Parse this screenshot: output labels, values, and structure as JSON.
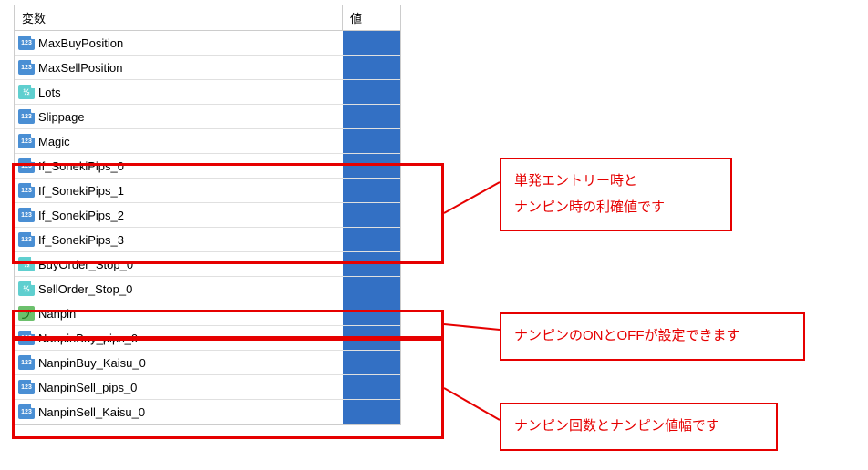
{
  "header": {
    "var_label": "変数",
    "val_label": "値"
  },
  "rows": [
    {
      "icon": "123",
      "name": "MaxBuyPosition"
    },
    {
      "icon": "123",
      "name": "MaxSellPosition"
    },
    {
      "icon": "v2",
      "name": "Lots"
    },
    {
      "icon": "123",
      "name": "Slippage"
    },
    {
      "icon": "123",
      "name": "Magic"
    },
    {
      "icon": "123",
      "name": "If_SonekiPips_0"
    },
    {
      "icon": "123",
      "name": "If_SonekiPips_1"
    },
    {
      "icon": "123",
      "name": "If_SonekiPips_2"
    },
    {
      "icon": "123",
      "name": "If_SonekiPips_3"
    },
    {
      "icon": "v2",
      "name": "BuyOrder_Stop_0"
    },
    {
      "icon": "v2",
      "name": "SellOrder_Stop_0"
    },
    {
      "icon": "nanpin",
      "name": "Nanpin"
    },
    {
      "icon": "123",
      "name": "NanpinBuy_pips_0"
    },
    {
      "icon": "123",
      "name": "NanpinBuy_Kaisu_0"
    },
    {
      "icon": "123",
      "name": "NanpinSell_pips_0"
    },
    {
      "icon": "123",
      "name": "NanpinSell_Kaisu_0"
    }
  ],
  "annotations": {
    "a1_line1": "単発エントリー時と",
    "a1_line2": "ナンピン時の利確値です",
    "a2": "ナンピンのONとOFFが設定できます",
    "a3": "ナンピン回数とナンピン値幅です"
  }
}
